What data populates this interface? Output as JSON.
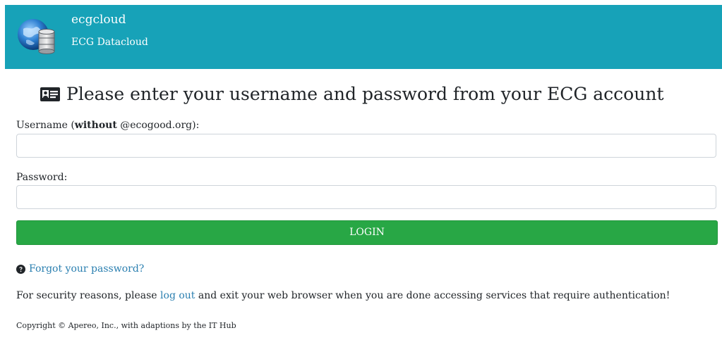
{
  "header": {
    "title": "ecgcloud",
    "subtitle": "ECG Datacloud",
    "logo_icon": "globe-database-icon",
    "background_color": "#17a2b8"
  },
  "heading": {
    "icon": "id-card-icon",
    "text": "Please enter your username and password from your ECG account"
  },
  "form": {
    "username_label_prefix": "Username (",
    "username_label_bold": "without",
    "username_label_suffix": " @ecogood.org):",
    "username_value": "",
    "password_label": "Password:",
    "password_value": "",
    "login_label": "LOGIN",
    "login_color": "#28a745"
  },
  "forgot": {
    "icon": "question-circle-icon",
    "text": "Forgot your password?"
  },
  "security": {
    "before": "For security reasons, please ",
    "link": "log out",
    "after": " and exit your web browser when you are done accessing services that require authentication!"
  },
  "footer": {
    "copyright": "Copyright © Apereo, Inc., with adaptions by the IT Hub"
  }
}
